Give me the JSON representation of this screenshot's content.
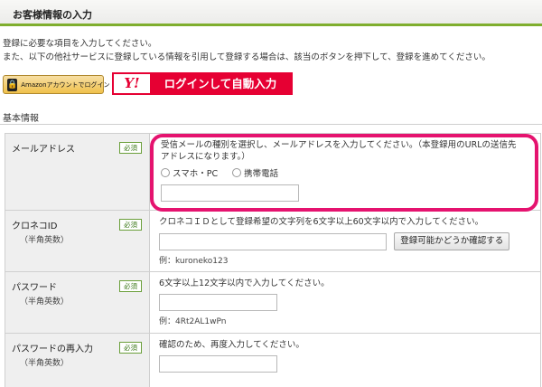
{
  "header": {
    "title": "お客様情報の入力"
  },
  "intro": {
    "line1": "登録に必要な項目を入力してください。",
    "line2": "また、以下の他社サービスに登録している情報を引用して登録する場合は、該当のボタンを押下して、登録を進めてください。"
  },
  "social": {
    "amazon_label": "Amazonアカウントでログイン",
    "yahoo_logo": "Y!",
    "yahoo_label": "ログインして自動入力"
  },
  "section": {
    "title": "基本情報"
  },
  "required_badge": "必須",
  "fields": {
    "email": {
      "label": "メールアドレス",
      "desc": "受信メールの種別を選択し、メールアドレスを入力してください。（本登録用のURLの送信先アドレスになります。）",
      "options": [
        "スマホ・PC",
        "携帯電話"
      ],
      "value": ""
    },
    "kuroneko": {
      "label": "クロネコID",
      "sub": "（半角英数）",
      "desc": "クロネコＩＤとして登録希望の文字列を6文字以上60文字以内で入力してください。",
      "check_button": "登録可能かどうか確認する",
      "example": "例：kuroneko123",
      "value": ""
    },
    "password": {
      "label": "パスワード",
      "sub": "（半角英数）",
      "desc": "6文字以上12文字以内で入力してください。",
      "example": "例：4Rt2AL1wPn",
      "value": ""
    },
    "password_confirm": {
      "label": "パスワードの再入力",
      "sub": "（半角英数）",
      "desc": "確認のため、再度入力してください。",
      "value": ""
    }
  },
  "colors": {
    "accent_green": "#7fae2e",
    "yahoo_red": "#e60033",
    "highlight_pink": "#e5136f",
    "amazon_gold": "#f0c14b"
  }
}
